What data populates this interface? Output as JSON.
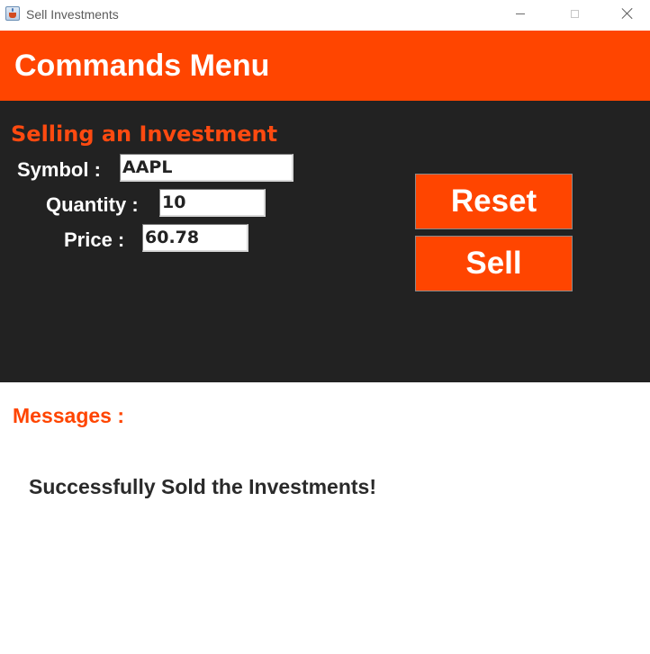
{
  "window": {
    "title": "Sell Investments"
  },
  "header": {
    "title": "Commands Menu"
  },
  "form": {
    "section_title": "Selling an Investment",
    "symbol": {
      "label": "Symbol :",
      "value": "AAPL"
    },
    "quantity": {
      "label": "Quantity :",
      "value": "10"
    },
    "price": {
      "label": "Price :",
      "value": "60.78"
    }
  },
  "buttons": {
    "reset": "Reset",
    "sell": "Sell"
  },
  "messages": {
    "label": "Messages :",
    "text": "Successfully Sold the Investments!"
  },
  "colors": {
    "accent": "#ff4500",
    "panel": "#222222",
    "background": "#ffffff"
  },
  "icons": {
    "app": "java-cup-icon",
    "minimize": "minimize-icon",
    "maximize": "maximize-icon",
    "close": "close-icon"
  }
}
